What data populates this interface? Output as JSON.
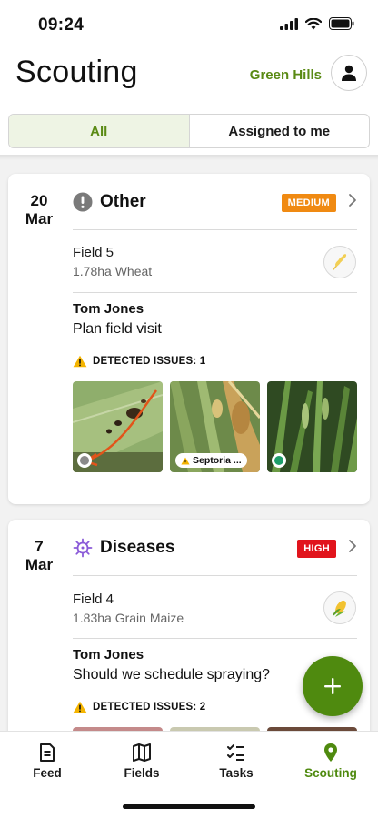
{
  "status": {
    "time": "09:24"
  },
  "header": {
    "title": "Scouting",
    "farm": "Green Hills"
  },
  "segments": {
    "all": "All",
    "assigned": "Assigned to me"
  },
  "cards": [
    {
      "day": "20",
      "month": "Mar",
      "category": "Other",
      "priority": "MEDIUM",
      "field": "Field 5",
      "meta": "1.78ha Wheat",
      "author": "Tom Jones",
      "note": "Plan field visit",
      "issues": "DETECTED ISSUES: 1",
      "photo_tag": "Septoria ..."
    },
    {
      "day": "7",
      "month": "Mar",
      "category": "Diseases",
      "priority": "HIGH",
      "field": "Field 4",
      "meta": "1.83ha Grain Maize",
      "author": "Tom Jones",
      "note": "Should we schedule spraying?",
      "issues": "DETECTED ISSUES: 2"
    }
  ],
  "tabs": {
    "feed": "Feed",
    "fields": "Fields",
    "tasks": "Tasks",
    "scouting": "Scouting"
  },
  "colors": {
    "brand_green": "#4f8a0f",
    "medium": "#f08a12",
    "high": "#e1141c"
  }
}
